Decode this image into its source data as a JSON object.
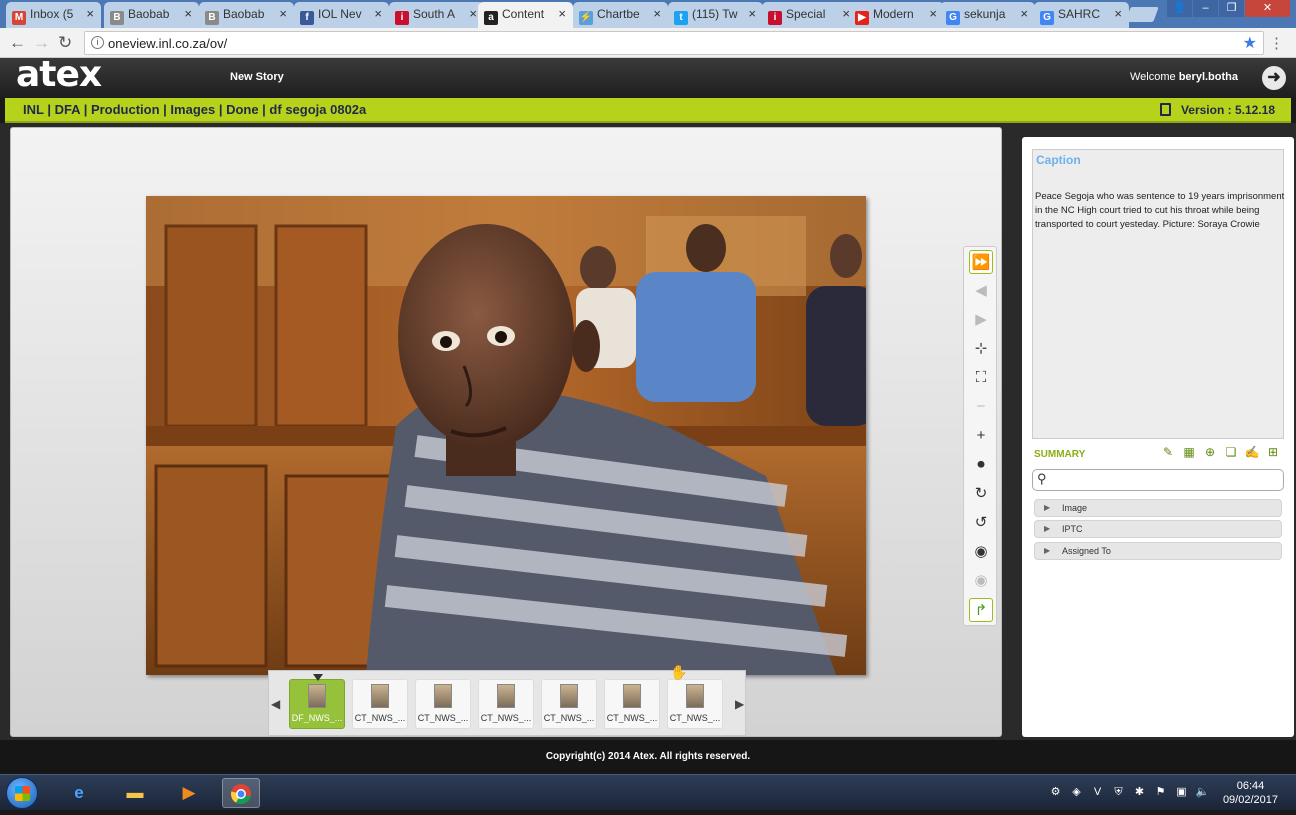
{
  "browser": {
    "tabs": [
      {
        "label": "Inbox (5",
        "fav": "M",
        "favcolor": "#d44638"
      },
      {
        "label": "Baobab",
        "fav": "B",
        "favcolor": "#8a8a8a"
      },
      {
        "label": "Baobab",
        "fav": "B",
        "favcolor": "#8a8a8a"
      },
      {
        "label": "IOL Nev",
        "fav": "f",
        "favcolor": "#3b5998"
      },
      {
        "label": "South A",
        "fav": "i",
        "favcolor": "#c8102e"
      },
      {
        "label": "Content",
        "fav": "a",
        "favcolor": "#222222"
      },
      {
        "label": "Chartbe",
        "fav": "⚡",
        "favcolor": "#5aa0d8"
      },
      {
        "label": "(115) Tw",
        "fav": "t",
        "favcolor": "#1da1f2"
      },
      {
        "label": "Special",
        "fav": "i",
        "favcolor": "#c8102e"
      },
      {
        "label": "Modern",
        "fav": "▶",
        "favcolor": "#e62117"
      },
      {
        "label": "sekunja",
        "fav": "G",
        "favcolor": "#4285f4"
      },
      {
        "label": "SAHRC",
        "fav": "G",
        "favcolor": "#4285f4"
      }
    ],
    "url": "oneview.inl.co.za/ov/"
  },
  "app": {
    "logo": "atex",
    "new_story": "New Story",
    "welcome_prefix": "Welcome",
    "username": "beryl.botha",
    "breadcrumb": "INL | DFA | Production | Images | Done | df segoja 0802a",
    "version": "Version : 5.12.18"
  },
  "filmstrip": {
    "thumbs": [
      "DF_NWS_...",
      "CT_NWS_...",
      "CT_NWS_...",
      "CT_NWS_...",
      "CT_NWS_...",
      "CT_NWS_...",
      "CT_NWS_..."
    ]
  },
  "panel": {
    "caption_title": "Caption",
    "caption_text": "Peace Segoja who was sentence to 19 years imprisonment in the NC High court tried to cut his throat while being transported to court yesteday. Picture: Soraya Crowie",
    "summary_label": "SUMMARY",
    "sections": [
      "Image",
      "IPTC",
      "Assigned To"
    ]
  },
  "footer": "Copyright(c) 2014 Atex. All rights reserved.",
  "taskbar": {
    "time": "06:44",
    "date": "09/02/2017"
  }
}
